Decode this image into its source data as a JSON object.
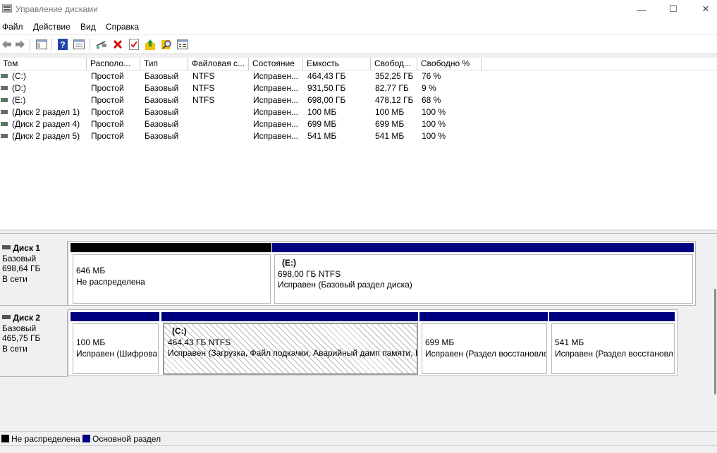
{
  "window": {
    "title": "Управление дисками",
    "minimize_icon": "—",
    "maximize_icon": "☐",
    "close_icon": "✕"
  },
  "menu": [
    "Файл",
    "Действие",
    "Вид",
    "Справка"
  ],
  "toolbar_icons": [
    "back-icon",
    "forward-icon",
    "console-tree-icon",
    "help-icon",
    "properties-icon",
    "connect-disk-icon",
    "delete-icon",
    "check-icon",
    "export-icon",
    "search-icon",
    "settings-icon"
  ],
  "columns": [
    "Том",
    "Располо...",
    "Тип",
    "Файловая с...",
    "Состояние",
    "Емкость",
    "Свобод...",
    "Свободно %"
  ],
  "volumes": [
    {
      "name": "(C:)",
      "layout": "Простой",
      "type": "Базовый",
      "fs": "NTFS",
      "status": "Исправен...",
      "capacity": "464,43 ГБ",
      "free": "352,25 ГБ",
      "free_pct": "76 %"
    },
    {
      "name": "(D:)",
      "layout": "Простой",
      "type": "Базовый",
      "fs": "NTFS",
      "status": "Исправен...",
      "capacity": "931,50 ГБ",
      "free": "82,77 ГБ",
      "free_pct": "9 %"
    },
    {
      "name": "(E:)",
      "layout": "Простой",
      "type": "Базовый",
      "fs": "NTFS",
      "status": "Исправен...",
      "capacity": "698,00 ГБ",
      "free": "478,12 ГБ",
      "free_pct": "68 %"
    },
    {
      "name": "(Диск 2 раздел 1)",
      "layout": "Простой",
      "type": "Базовый",
      "fs": "",
      "status": "Исправен...",
      "capacity": "100 МБ",
      "free": "100 МБ",
      "free_pct": "100 %"
    },
    {
      "name": "(Диск 2 раздел 4)",
      "layout": "Простой",
      "type": "Базовый",
      "fs": "",
      "status": "Исправен...",
      "capacity": "699 МБ",
      "free": "699 МБ",
      "free_pct": "100 %"
    },
    {
      "name": "(Диск 2 раздел 5)",
      "layout": "Простой",
      "type": "Базовый",
      "fs": "",
      "status": "Исправен...",
      "capacity": "541 МБ",
      "free": "541 МБ",
      "free_pct": "100 %"
    }
  ],
  "disks": [
    {
      "name": "Диск 1",
      "type": "Базовый",
      "size": "698,64 ГБ",
      "state": "В сети",
      "partitions": [
        {
          "label": "",
          "size": "646 МБ",
          "status": "Не распределена",
          "kind": "unallocated"
        },
        {
          "label": "(E:)",
          "size": "698,00 ГБ NTFS",
          "status": "Исправен (Базовый раздел диска)",
          "kind": "primary"
        }
      ]
    },
    {
      "name": "Диск 2",
      "type": "Базовый",
      "size": "465,75 ГБ",
      "state": "В сети",
      "partitions": [
        {
          "label": "",
          "size": "100 МБ",
          "status": "Исправен (Шифрова",
          "kind": "primary"
        },
        {
          "label": "(C:)",
          "size": "464,43 ГБ NTFS",
          "status": "Исправен (Загрузка, Файл подкачки, Аварийный дамп памяти, I",
          "kind": "primary",
          "selected": true
        },
        {
          "label": "",
          "size": "699 МБ",
          "status": "Исправен (Раздел восстановле",
          "kind": "primary"
        },
        {
          "label": "",
          "size": "541 МБ",
          "status": "Исправен (Раздел восстановл",
          "kind": "primary"
        }
      ]
    }
  ],
  "legend": [
    {
      "label": "Не распределена",
      "color": "#000000"
    },
    {
      "label": "Основной раздел",
      "color": "#000080"
    }
  ],
  "colors": {
    "primary": "#000080",
    "unallocated": "#000000"
  }
}
